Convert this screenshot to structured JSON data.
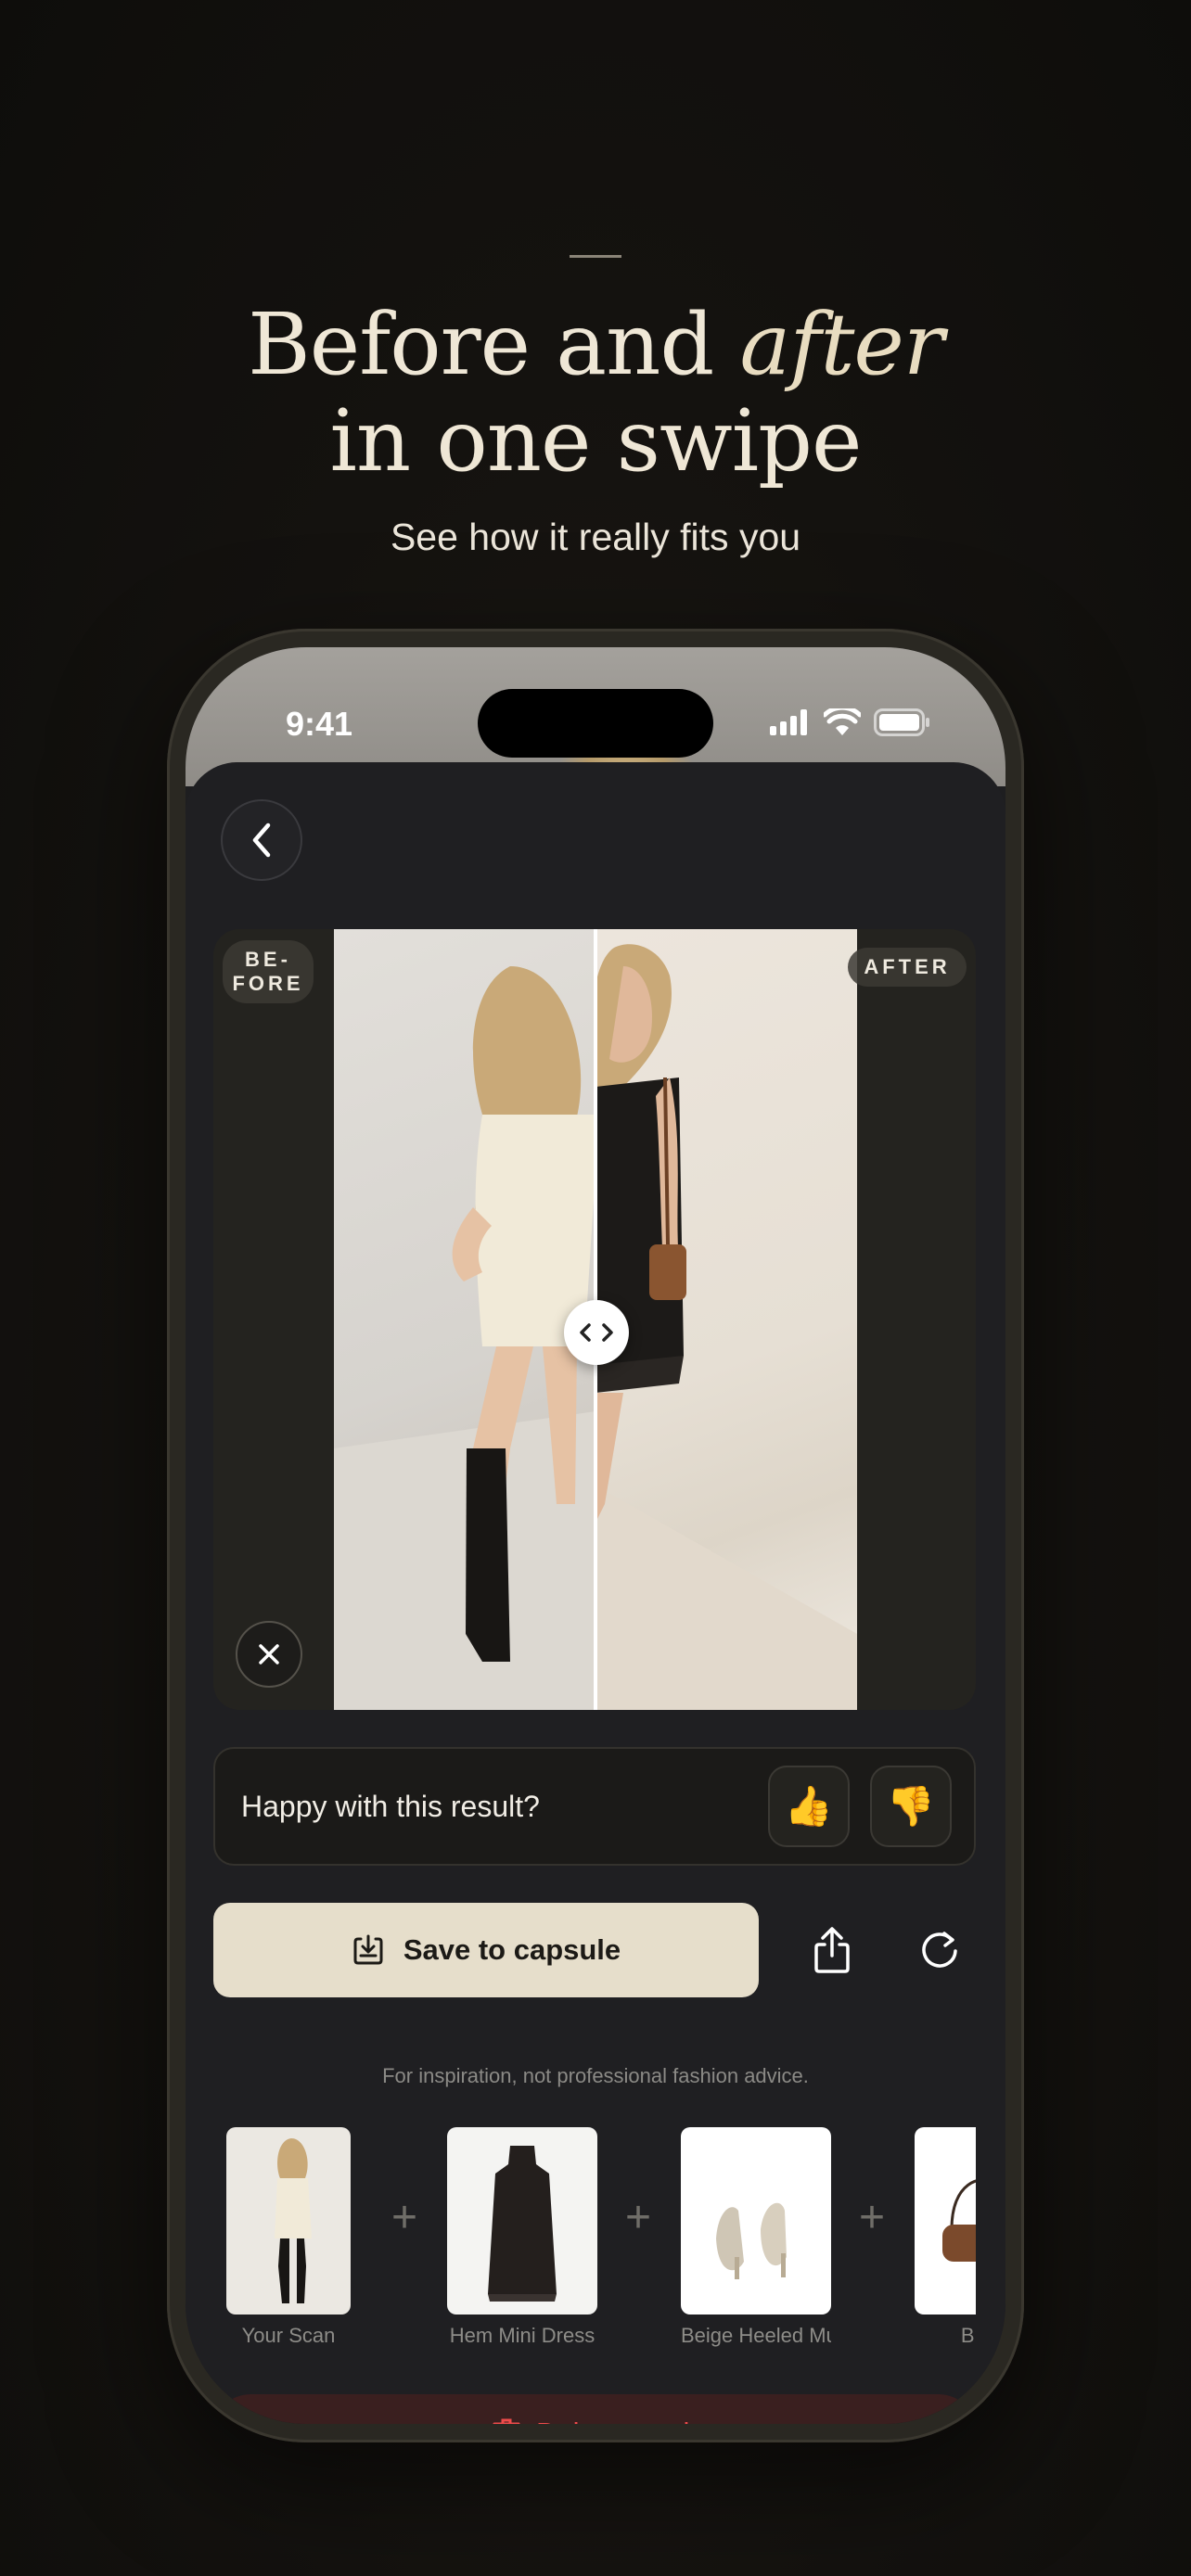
{
  "hero": {
    "headline_part1": "Before and ",
    "headline_emphasis": "after",
    "headline_line2": "in one swipe",
    "subheadline": "See how it really fits you"
  },
  "status_bar": {
    "time": "9:41"
  },
  "compare": {
    "before_label": "BE-\nFORE",
    "after_label": "AFTER",
    "split_position": 0.5
  },
  "feedback": {
    "question": "Happy with this result?",
    "thumbs_up": "👍",
    "thumbs_down": "👎"
  },
  "actions": {
    "save_label": "Save to capsule"
  },
  "disclaimer": "For inspiration, not professional fashion advice.",
  "items": [
    {
      "label": "Your Scan"
    },
    {
      "label": "Hem Mini Dress"
    },
    {
      "label": "Beige Heeled Mu"
    },
    {
      "label": "Brown"
    }
  ],
  "delete": {
    "label": "Delete result"
  },
  "colors": {
    "accent_cream": "#e6decb",
    "danger": "#ef4b4b",
    "sheet_bg": "#1f1f22"
  }
}
